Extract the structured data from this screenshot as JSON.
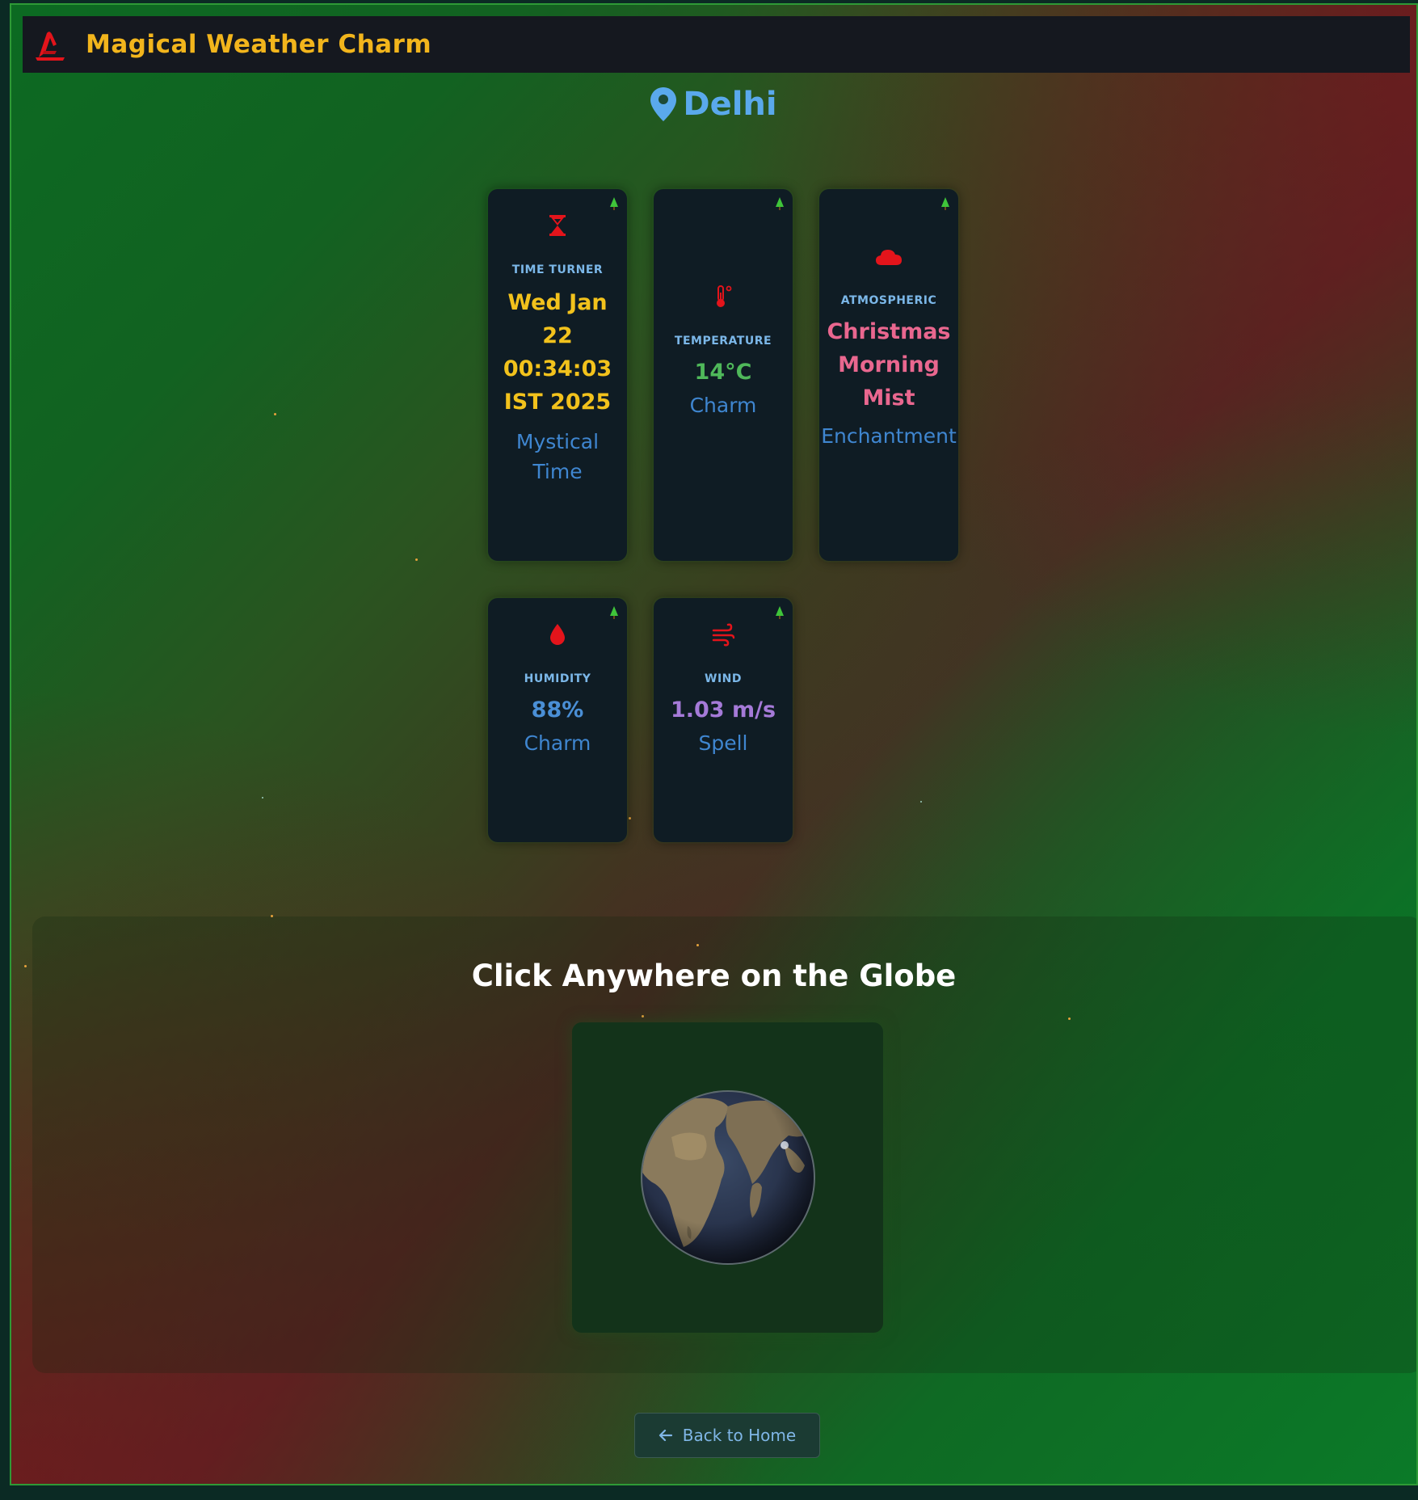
{
  "header": {
    "title": "Magical Weather Charm",
    "logo_icon": "wizard-hat-icon"
  },
  "location": {
    "city": "Delhi",
    "icon": "map-pin-icon"
  },
  "cards": {
    "time": {
      "icon": "hourglass-icon",
      "label": "TIME TURNER",
      "value_lines": [
        "Wed Jan",
        "22",
        "00:34:03",
        "IST 2025"
      ],
      "sub_lines": [
        "Mystical",
        "Time"
      ],
      "value_color": "#f2c21c"
    },
    "temperature": {
      "icon": "thermometer-icon",
      "label": "TEMPERATURE",
      "value": "14°C",
      "sub": "Charm",
      "value_color": "#4fb85a"
    },
    "atmospheric": {
      "icon": "cloud-icon",
      "label": "ATMOSPHERIC",
      "value_lines": [
        "Christmas",
        "Morning",
        "Mist"
      ],
      "sub": "Enchantment",
      "value_color": "#e9678f"
    },
    "humidity": {
      "icon": "water-drop-icon",
      "label": "HUMIDITY",
      "value": "88%",
      "sub": "Charm",
      "value_color": "#4a8fd6"
    },
    "wind": {
      "icon": "wind-icon",
      "label": "WIND",
      "value": "1.03 m/s",
      "sub": "Spell",
      "value_color": "#a57ad8"
    }
  },
  "globe": {
    "title": "Click Anywhere on the Globe",
    "icon": "globe-icon"
  },
  "back_button": {
    "label": "Back to Home",
    "icon": "arrow-left-icon"
  },
  "colors": {
    "accent_gold": "#f2b51c",
    "icon_red": "#e3141b",
    "card_bg": "#0f1c24",
    "label_blue": "#7bb7e8",
    "sub_blue": "#3f86d0"
  }
}
